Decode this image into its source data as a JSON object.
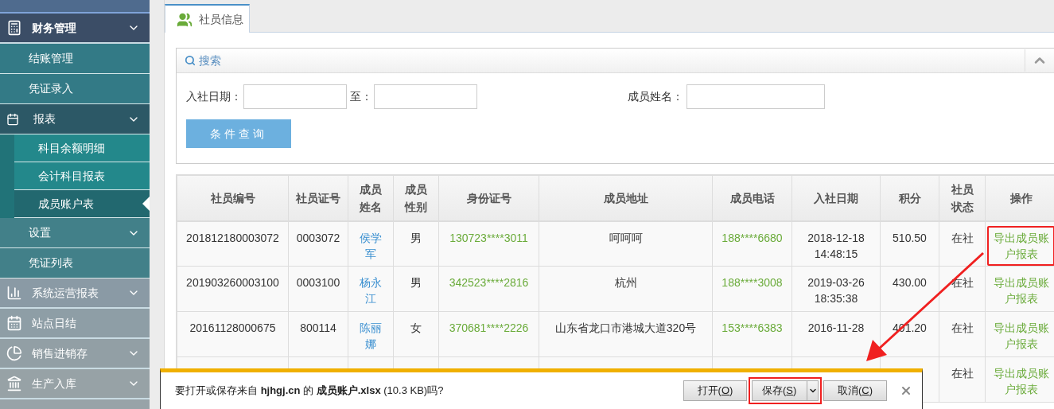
{
  "sidebar": {
    "items": [
      {
        "label": "财务管理",
        "has_submenu": true,
        "expanded": true,
        "children": [
          {
            "label": "结账管理"
          },
          {
            "label": "凭证录入"
          },
          {
            "label": "报表",
            "has_submenu": true,
            "expanded": true,
            "children": [
              {
                "label": "科目余额明细",
                "selected": false
              },
              {
                "label": "会计科目报表",
                "selected": false
              },
              {
                "label": "成员账户表",
                "selected": true
              }
            ]
          },
          {
            "label": "设置",
            "has_submenu": true
          },
          {
            "label": "凭证列表"
          }
        ]
      },
      {
        "label": "系统运营报表",
        "has_submenu": true
      },
      {
        "label": "站点日结"
      },
      {
        "label": "销售进销存",
        "has_submenu": true
      },
      {
        "label": "生产入库",
        "has_submenu": true
      }
    ]
  },
  "tabs": [
    {
      "label": "社员信息",
      "selected": true
    }
  ],
  "search": {
    "title": "搜索",
    "fields": [
      {
        "label": "入社日期："
      },
      {
        "label": "至："
      },
      {
        "label": "成员姓名："
      }
    ],
    "button": "条件查询"
  },
  "table": {
    "columns": [
      "社员编号",
      "社员证号",
      "成员姓名",
      "成员性别",
      "身份证号",
      "成员地址",
      "成员电话",
      "入社日期",
      "积分",
      "社员状态",
      "操作"
    ],
    "rows": [
      {
        "cells": [
          {
            "kind": "text",
            "text": "201812180003072"
          },
          {
            "kind": "text",
            "text": "0003072"
          },
          {
            "kind": "link",
            "text": "侯学军"
          },
          {
            "kind": "text",
            "text": "男"
          },
          {
            "kind": "green",
            "text": "130723****3011"
          },
          {
            "kind": "text",
            "text": "呵呵呵"
          },
          {
            "kind": "green",
            "text": "188****6680"
          },
          {
            "kind": "text",
            "text": "2018-12-18 14:48:15"
          },
          {
            "kind": "text",
            "text": "510.50"
          },
          {
            "kind": "text",
            "text": "在社"
          },
          {
            "kind": "action",
            "text": "导出成员账户报表",
            "highlighted": true
          }
        ]
      },
      {
        "cells": [
          {
            "kind": "text",
            "text": "201903260003100"
          },
          {
            "kind": "text",
            "text": "0003100"
          },
          {
            "kind": "link",
            "text": "杨永江"
          },
          {
            "kind": "text",
            "text": "男"
          },
          {
            "kind": "green",
            "text": "342523****2816"
          },
          {
            "kind": "text",
            "text": "杭州"
          },
          {
            "kind": "green",
            "text": "188****3008"
          },
          {
            "kind": "text",
            "text": "2019-03-26 18:35:38"
          },
          {
            "kind": "text",
            "text": "430.00"
          },
          {
            "kind": "text",
            "text": "在社"
          },
          {
            "kind": "action",
            "text": "导出成员账户报表"
          }
        ]
      },
      {
        "cells": [
          {
            "kind": "text",
            "text": "20161128000675"
          },
          {
            "kind": "text",
            "text": "800114"
          },
          {
            "kind": "link",
            "text": "陈丽娜"
          },
          {
            "kind": "text",
            "text": "女"
          },
          {
            "kind": "green",
            "text": "370681****2226"
          },
          {
            "kind": "text",
            "text": "山东省龙口市港城大道320号"
          },
          {
            "kind": "green",
            "text": "153****6383"
          },
          {
            "kind": "text",
            "text": "2016-11-28"
          },
          {
            "kind": "text",
            "text": "401.20"
          },
          {
            "kind": "text",
            "text": "在社"
          },
          {
            "kind": "action",
            "text": "导出成员账户报表"
          }
        ]
      },
      {
        "cells": [
          {
            "kind": "text"
          },
          {
            "kind": "text"
          },
          {
            "kind": "link"
          },
          {
            "kind": "text"
          },
          {
            "kind": "green"
          },
          {
            "kind": "text"
          },
          {
            "kind": "green"
          },
          {
            "kind": "text"
          },
          {
            "kind": "text"
          },
          {
            "kind": "text",
            "text": "在社"
          },
          {
            "kind": "action",
            "text": "导出成员账户报表"
          }
        ]
      }
    ]
  },
  "download_bar": {
    "message": "要打开或保存来自 **hjhgj.cn** 的 **成员账户.xlsx** (10.3 KB)吗?",
    "buttons": [
      {
        "label": "打开(",
        "key": "O",
        "suffix": ")",
        "split": false
      },
      {
        "label": "保存(",
        "key": "S",
        "suffix": ")",
        "split": true,
        "highlighted": true
      },
      {
        "label": "取消(",
        "key": "C",
        "suffix": ")",
        "split": false
      }
    ]
  }
}
